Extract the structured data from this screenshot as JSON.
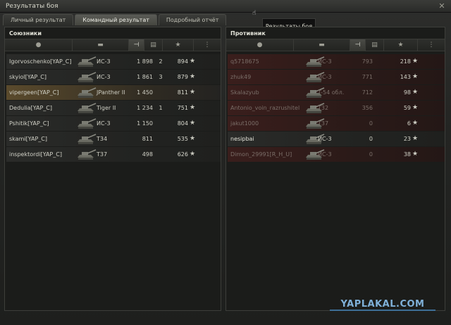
{
  "window": {
    "title": "Результаты боя",
    "close_glyph": "✕"
  },
  "tabs": [
    {
      "label": "Личный результат",
      "active": false
    },
    {
      "label": "Командный результат",
      "active": true
    },
    {
      "label": "Подробный отчёт",
      "active": false
    }
  ],
  "tooltip": "Результаты боя",
  "allies": {
    "title": "Союзники",
    "header_icons": [
      "person-icon",
      "tank-icon",
      "sort-chevron-icon",
      "damage-icon",
      "kills-icon",
      "star-icon",
      "status-icon"
    ],
    "rows": [
      {
        "name": "Igorvoschenko[YAP_C]",
        "vehicle": "ИС-3",
        "damage": "1 898",
        "kills": "2",
        "xp": "894",
        "state": "normal"
      },
      {
        "name": "skyiol[YAP_C]",
        "vehicle": "ИС-3",
        "damage": "1 861",
        "kills": "3",
        "xp": "879",
        "state": "normal"
      },
      {
        "name": "vipergeen[YAP_C]",
        "vehicle": "JPanther II",
        "damage": "1 450",
        "kills": "",
        "xp": "811",
        "state": "player"
      },
      {
        "name": "Dedulia[YAP_C]",
        "vehicle": "Tiger II",
        "damage": "1 234",
        "kills": "1",
        "xp": "751",
        "state": "normal"
      },
      {
        "name": "Pshitik[YAP_C]",
        "vehicle": "ИС-3",
        "damage": "1 150",
        "kills": "",
        "xp": "804",
        "state": "normal"
      },
      {
        "name": "skami[YAP_C]",
        "vehicle": "T34",
        "damage": "811",
        "kills": "",
        "xp": "535",
        "state": "normal"
      },
      {
        "name": "inspektordi[YAP_C]",
        "vehicle": "T37",
        "damage": "498",
        "kills": "",
        "xp": "626",
        "state": "normal"
      }
    ]
  },
  "enemies": {
    "title": "Противник",
    "rows": [
      {
        "name": "q5718675",
        "vehicle": "ИС-3",
        "damage": "793",
        "xp": "218",
        "state": "dead"
      },
      {
        "name": "zhuk49",
        "vehicle": "ИС-3",
        "damage": "771",
        "xp": "143",
        "state": "dead"
      },
      {
        "name": "Skalazyub",
        "vehicle": "T-54 обл.",
        "damage": "712",
        "xp": "98",
        "state": "dead"
      },
      {
        "name": "Antonio_voin_razrushitel",
        "vehicle": "T32",
        "damage": "356",
        "xp": "59",
        "state": "dead"
      },
      {
        "name": "jakut1000",
        "vehicle": "T37",
        "damage": "0",
        "xp": "6",
        "state": "dead"
      },
      {
        "name": "nesipbai",
        "vehicle": "ИС-3",
        "damage": "0",
        "xp": "23",
        "state": "alive"
      },
      {
        "name": "Dimon_29991[R_H_U]",
        "vehicle": "ИС-3",
        "damage": "0",
        "xp": "38",
        "state": "dead"
      }
    ]
  },
  "star_glyph": "★",
  "watermark": "YAPLAKAL.COM"
}
